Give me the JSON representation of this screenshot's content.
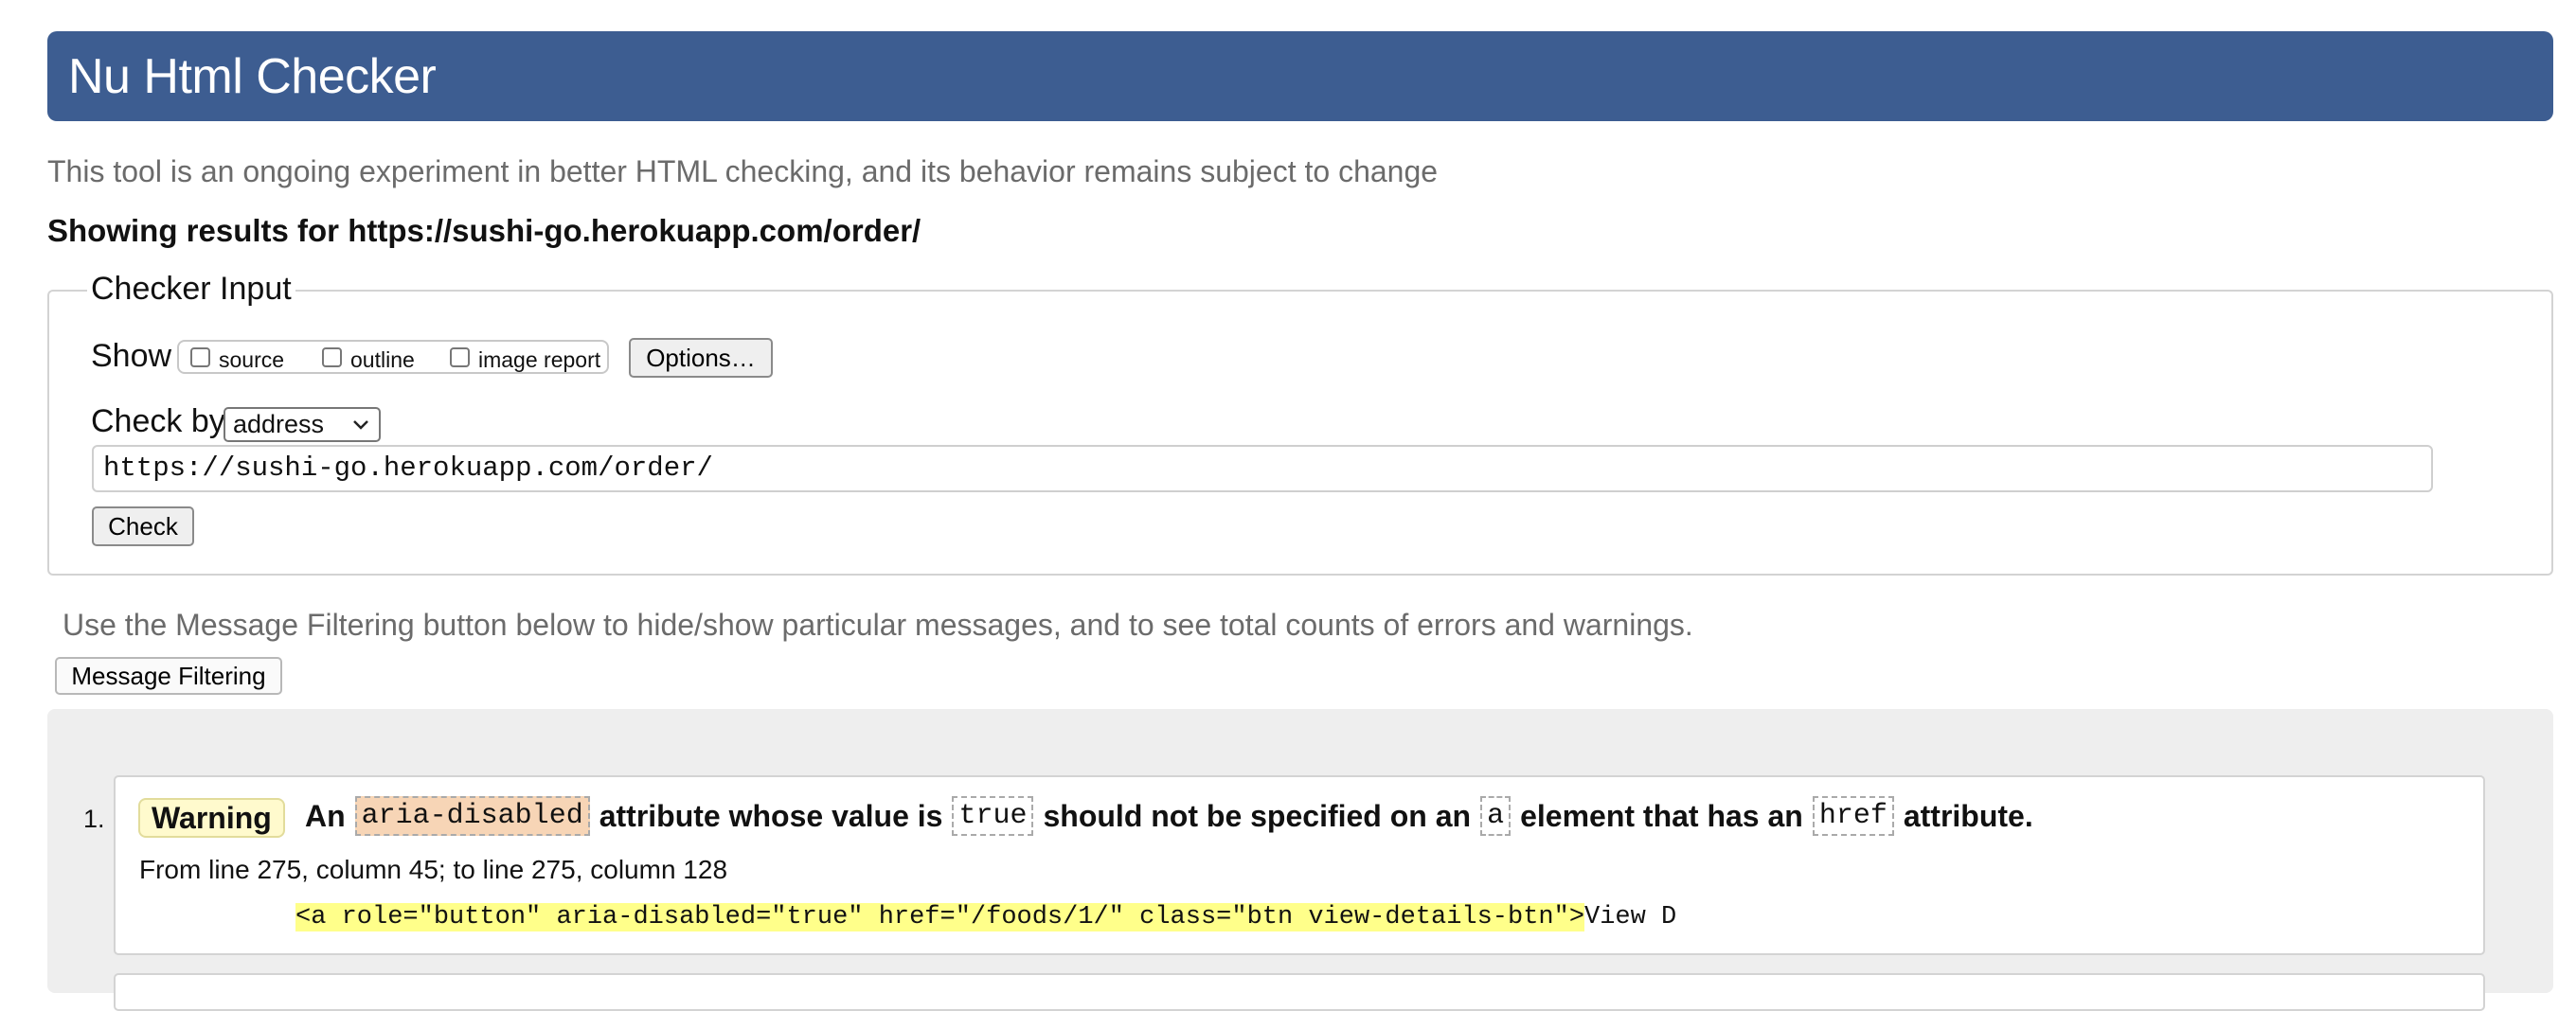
{
  "header": {
    "title": "Nu Html Checker"
  },
  "tagline": "This tool is an ongoing experiment in better HTML checking, and its behavior remains subject to change",
  "showing_results": "Showing results for https://sushi-go.herokuapp.com/order/",
  "checker_input": {
    "legend": "Checker Input",
    "show_label": "Show",
    "show_options": [
      {
        "label": "source",
        "checked": false
      },
      {
        "label": "outline",
        "checked": false
      },
      {
        "label": "image report",
        "checked": false
      }
    ],
    "options_button": "Options…",
    "check_by_label": "Check by",
    "check_by_value": "address",
    "url_value": "https://sushi-go.herokuapp.com/order/",
    "check_button": "Check"
  },
  "filter_note": "Use the Message Filtering button below to hide/show particular messages, and to see total counts of errors and warnings.",
  "filter_button": "Message Filtering",
  "messages": [
    {
      "number": "1.",
      "type": "Warning",
      "parts": {
        "p1": "An",
        "c1": "aria-disabled",
        "p2": "attribute whose value is",
        "c2": "true",
        "p3": "should not be specified on an",
        "c3": "a",
        "p4": "element that has an",
        "c4": "href",
        "p5": "attribute."
      },
      "location": "From line 275, column 45; to line 275, column 128",
      "extract_highlight": "<a role=\"button\" aria-disabled=\"true\" href=\"/foods/1/\" class=\"btn view-details-btn\">",
      "extract_rest": "View D"
    }
  ],
  "colors": {
    "header_bg": "#3d5d91",
    "warning_badge_bg": "#fffacd",
    "highlight_code_bg": "#f7d5b6",
    "extract_highlight_bg": "#ffff8a"
  }
}
